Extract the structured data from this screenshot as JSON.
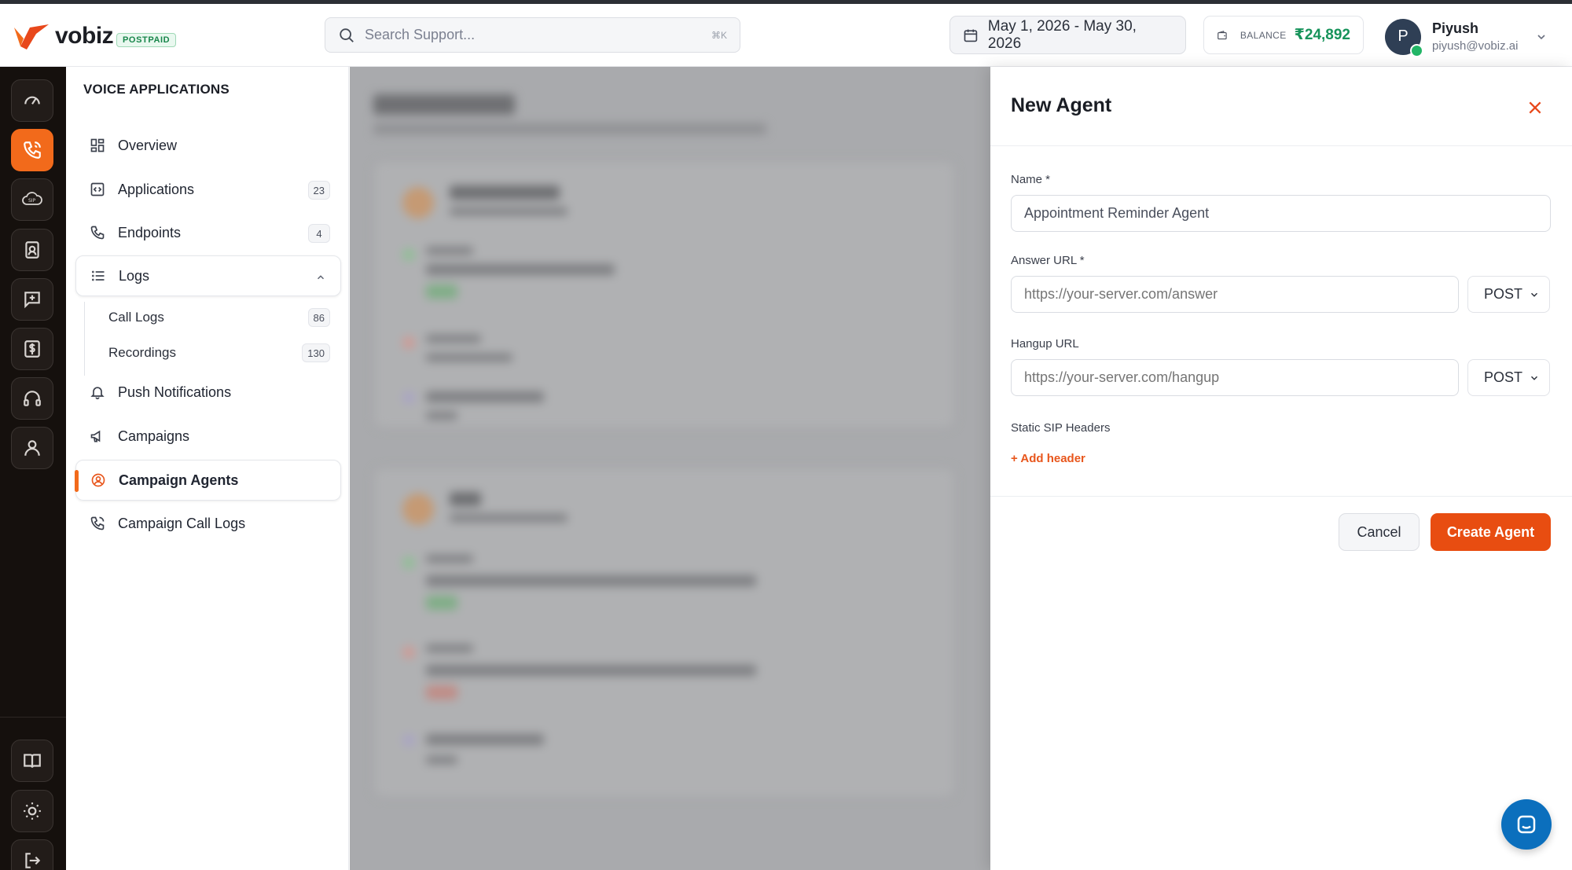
{
  "app": {
    "brand": "vobiz",
    "plan_badge": "POSTPAID"
  },
  "header": {
    "search_placeholder": "Search Support...",
    "search_shortcut": "⌘K",
    "date_range": "May 1, 2026 - May 30, 2026",
    "balance_label": "BALANCE",
    "balance_amount": "₹24,892",
    "user_initial": "P",
    "user_name": "Piyush",
    "user_email": "piyush@vobiz.ai"
  },
  "rail": {
    "items": [
      "dashboard-icon",
      "phone-icon",
      "sip-cloud-icon",
      "contact-badge-icon",
      "message-plus-icon",
      "billing-icon",
      "headset-icon",
      "user-icon"
    ],
    "bottom": [
      "book-icon",
      "sun-icon",
      "logout-icon"
    ],
    "active_index": 1
  },
  "sidebar": {
    "title": "VOICE APPLICATIONS",
    "items": [
      {
        "label": "Overview"
      },
      {
        "label": "Applications",
        "count": "23"
      },
      {
        "label": "Endpoints",
        "count": "4"
      },
      {
        "label": "Logs"
      },
      {
        "label": "Push Notifications"
      },
      {
        "label": "Campaigns"
      },
      {
        "label": "Campaign Agents"
      },
      {
        "label": "Campaign Call Logs"
      }
    ],
    "logs_sub": [
      {
        "label": "Call Logs",
        "count": "86"
      },
      {
        "label": "Recordings",
        "count": "130"
      }
    ]
  },
  "drawer": {
    "title": "New Agent",
    "name_label": "Name *",
    "name_value": "Appointment Reminder Agent",
    "answer_label": "Answer URL *",
    "answer_placeholder": "https://your-server.com/answer",
    "answer_method": "POST",
    "hangup_label": "Hangup URL",
    "hangup_placeholder": "https://your-server.com/hangup",
    "hangup_method": "POST",
    "sip_label": "Static SIP Headers",
    "add_header": "+ Add header",
    "cancel": "Cancel",
    "create": "Create Agent"
  },
  "colors": {
    "accent": "#f26a1b",
    "primary_button": "#e84d11",
    "balance": "#16935a",
    "rail_bg": "#15100d",
    "chat": "#0b6fbd"
  }
}
